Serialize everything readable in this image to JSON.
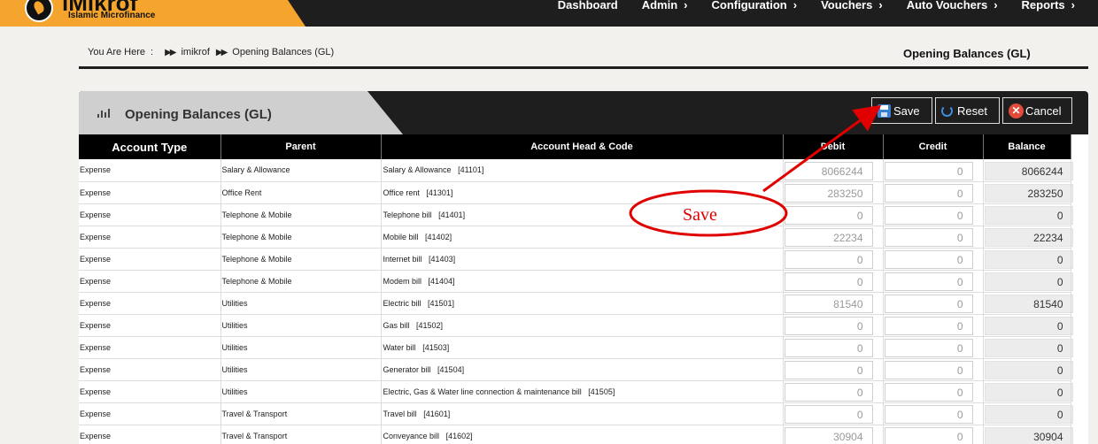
{
  "brand": {
    "name": "iMikrof",
    "tagline": "Islamic Microfinance"
  },
  "nav": [
    {
      "label": "Dashboard",
      "chevron": false
    },
    {
      "label": "Admin",
      "chevron": true
    },
    {
      "label": "Configuration",
      "chevron": true
    },
    {
      "label": "Vouchers",
      "chevron": true
    },
    {
      "label": "Auto Vouchers",
      "chevron": true
    },
    {
      "label": "Reports",
      "chevron": true
    }
  ],
  "breadcrumb": {
    "prefix": "You Are Here",
    "colon": ":",
    "separator": "▶▶",
    "items": [
      "imikrof",
      "Opening Balances (GL)"
    ]
  },
  "page_title": "Opening Balances (GL)",
  "panel": {
    "title": "Opening Balances (GL)",
    "buttons": {
      "save": "Save",
      "reset": "Reset",
      "cancel": "Cancel"
    },
    "cancel_glyph": "✕"
  },
  "table": {
    "columns": [
      "Account Type",
      "Parent",
      "Account Head & Code",
      "Debit",
      "Credit",
      "Balance"
    ],
    "rows": [
      {
        "type": "Expense",
        "parent": "Salary & Allowance",
        "head": "Salary & Allowance",
        "code": "[41101]",
        "debit": "8066244",
        "credit": "0",
        "balance": "8066244"
      },
      {
        "type": "Expense",
        "parent": "Office Rent",
        "head": "Office rent",
        "code": "[41301]",
        "debit": "283250",
        "credit": "0",
        "balance": "283250"
      },
      {
        "type": "Expense",
        "parent": "Telephone & Mobile",
        "head": "Telephone bill",
        "code": "[41401]",
        "debit": "0",
        "credit": "0",
        "balance": "0"
      },
      {
        "type": "Expense",
        "parent": "Telephone & Mobile",
        "head": "Mobile bill",
        "code": "[41402]",
        "debit": "22234",
        "credit": "0",
        "balance": "22234"
      },
      {
        "type": "Expense",
        "parent": "Telephone & Mobile",
        "head": "Internet bill",
        "code": "[41403]",
        "debit": "0",
        "credit": "0",
        "balance": "0"
      },
      {
        "type": "Expense",
        "parent": "Telephone & Mobile",
        "head": "Modem bill",
        "code": "[41404]",
        "debit": "0",
        "credit": "0",
        "balance": "0"
      },
      {
        "type": "Expense",
        "parent": "Utilities",
        "head": "Electric bill",
        "code": "[41501]",
        "debit": "81540",
        "credit": "0",
        "balance": "81540"
      },
      {
        "type": "Expense",
        "parent": "Utilities",
        "head": "Gas bill",
        "code": "[41502]",
        "debit": "0",
        "credit": "0",
        "balance": "0"
      },
      {
        "type": "Expense",
        "parent": "Utilities",
        "head": "Water bill",
        "code": "[41503]",
        "debit": "0",
        "credit": "0",
        "balance": "0"
      },
      {
        "type": "Expense",
        "parent": "Utilities",
        "head": "Generator bill",
        "code": "[41504]",
        "debit": "0",
        "credit": "0",
        "balance": "0"
      },
      {
        "type": "Expense",
        "parent": "Utilities",
        "head": "Electric, Gas & Water line connection & maintenance bill",
        "code": "[41505]",
        "debit": "0",
        "credit": "0",
        "balance": "0"
      },
      {
        "type": "Expense",
        "parent": "Travel & Transport",
        "head": "Travel bill",
        "code": "[41601]",
        "debit": "0",
        "credit": "0",
        "balance": "0"
      },
      {
        "type": "Expense",
        "parent": "Travel & Transport",
        "head": "Conveyance bill",
        "code": "[41602]",
        "debit": "30904",
        "credit": "0",
        "balance": "30904"
      }
    ]
  },
  "annotation": {
    "label": "Save",
    "color": "#e00000"
  },
  "colors": {
    "brand": "#f5a52d",
    "topbar": "#1e1e1e",
    "tab": "#cfcfcf",
    "header_row": "#000000"
  }
}
